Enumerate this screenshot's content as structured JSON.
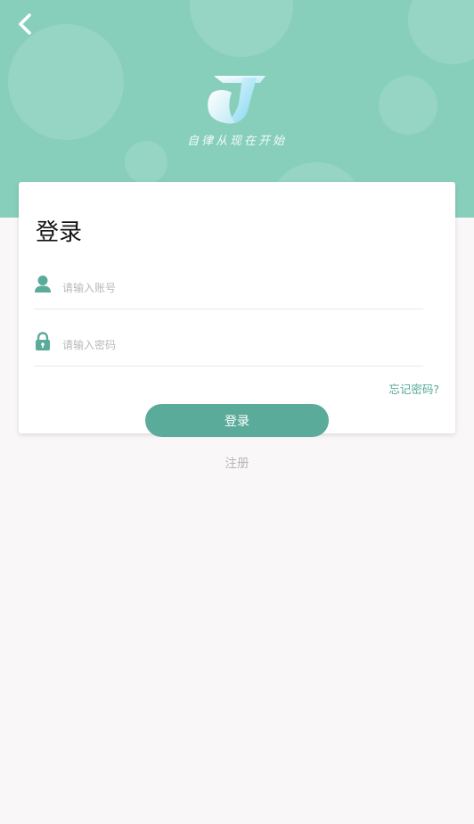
{
  "header": {
    "back_icon": "chevron-left-icon",
    "logo_icon": "j-logo-icon",
    "slogan": "自律从现在开始",
    "background_color": "#88cfbb"
  },
  "login_card": {
    "title": "登录",
    "username": {
      "icon": "user-icon",
      "placeholder": "请输入账号",
      "value": ""
    },
    "password": {
      "icon": "lock-icon",
      "placeholder": "请输入密码",
      "value": ""
    },
    "forgot_password_label": "忘记密码?"
  },
  "login_button_label": "登录",
  "register_label": "注册",
  "colors": {
    "accent": "#5bab9b",
    "link": "#55a896",
    "muted_text": "#b7b7b7"
  }
}
